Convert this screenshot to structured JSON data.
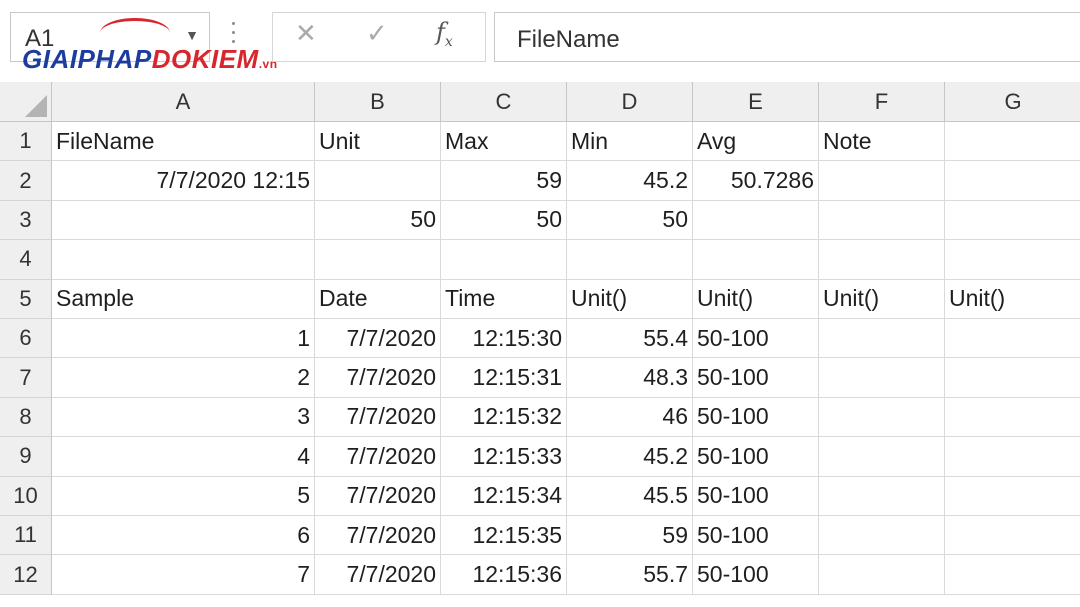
{
  "formula_bar": {
    "name_box": "A1",
    "name_box_caret": "▼",
    "cancel_glyph": "✕",
    "enter_glyph": "✓",
    "fx_glyph": "f",
    "fx_sub": "x",
    "content": "FileName"
  },
  "watermark": {
    "part1": "GIAIPHAP",
    "part2": "DOKIEM",
    "part3": ".vn"
  },
  "icons": {
    "cancel": "close-icon",
    "enter": "check-icon",
    "fx": "function-icon",
    "dropdown": "chevron-down-icon",
    "select_all": "select-all-triangle-icon"
  },
  "colors": {
    "watermark_blue": "#1d3d9e",
    "watermark_red": "#d8262d",
    "header_bg": "#efefef",
    "selection": "#217346"
  },
  "columns": [
    "A",
    "B",
    "C",
    "D",
    "E",
    "F",
    "G"
  ],
  "rows": [
    {
      "num": "1",
      "cells": [
        {
          "v": "FileName",
          "a": "left"
        },
        {
          "v": "Unit",
          "a": "left"
        },
        {
          "v": "Max",
          "a": "left"
        },
        {
          "v": "Min",
          "a": "left"
        },
        {
          "v": "Avg",
          "a": "left"
        },
        {
          "v": "Note",
          "a": "left"
        },
        {
          "v": "",
          "a": "left"
        }
      ]
    },
    {
      "num": "2",
      "cells": [
        {
          "v": "7/7/2020 12:15",
          "a": "right"
        },
        {
          "v": "",
          "a": "left"
        },
        {
          "v": "59",
          "a": "right"
        },
        {
          "v": "45.2",
          "a": "right"
        },
        {
          "v": "50.7286",
          "a": "right"
        },
        {
          "v": "",
          "a": "left"
        },
        {
          "v": "",
          "a": "left"
        }
      ]
    },
    {
      "num": "3",
      "cells": [
        {
          "v": "",
          "a": "left"
        },
        {
          "v": "50",
          "a": "right"
        },
        {
          "v": "50",
          "a": "right"
        },
        {
          "v": "50",
          "a": "right"
        },
        {
          "v": "",
          "a": "left"
        },
        {
          "v": "",
          "a": "left"
        },
        {
          "v": "",
          "a": "left"
        }
      ]
    },
    {
      "num": "4",
      "cells": [
        {
          "v": "",
          "a": "left"
        },
        {
          "v": "",
          "a": "left"
        },
        {
          "v": "",
          "a": "left"
        },
        {
          "v": "",
          "a": "left"
        },
        {
          "v": "",
          "a": "left"
        },
        {
          "v": "",
          "a": "left"
        },
        {
          "v": "",
          "a": "left"
        }
      ]
    },
    {
      "num": "5",
      "cells": [
        {
          "v": "Sample",
          "a": "left"
        },
        {
          "v": "Date",
          "a": "left"
        },
        {
          "v": "Time",
          "a": "left"
        },
        {
          "v": "Unit()",
          "a": "left"
        },
        {
          "v": "Unit()",
          "a": "left"
        },
        {
          "v": "Unit()",
          "a": "left"
        },
        {
          "v": "Unit()",
          "a": "left"
        }
      ]
    },
    {
      "num": "6",
      "cells": [
        {
          "v": "1",
          "a": "right"
        },
        {
          "v": "7/7/2020",
          "a": "right"
        },
        {
          "v": "12:15:30",
          "a": "right"
        },
        {
          "v": "55.4",
          "a": "right"
        },
        {
          "v": "50-100",
          "a": "left"
        },
        {
          "v": "",
          "a": "left"
        },
        {
          "v": "",
          "a": "left"
        }
      ]
    },
    {
      "num": "7",
      "cells": [
        {
          "v": "2",
          "a": "right"
        },
        {
          "v": "7/7/2020",
          "a": "right"
        },
        {
          "v": "12:15:31",
          "a": "right"
        },
        {
          "v": "48.3",
          "a": "right"
        },
        {
          "v": "50-100",
          "a": "left"
        },
        {
          "v": "",
          "a": "left"
        },
        {
          "v": "",
          "a": "left"
        }
      ]
    },
    {
      "num": "8",
      "cells": [
        {
          "v": "3",
          "a": "right"
        },
        {
          "v": "7/7/2020",
          "a": "right"
        },
        {
          "v": "12:15:32",
          "a": "right"
        },
        {
          "v": "46",
          "a": "right"
        },
        {
          "v": "50-100",
          "a": "left"
        },
        {
          "v": "",
          "a": "left"
        },
        {
          "v": "",
          "a": "left"
        }
      ]
    },
    {
      "num": "9",
      "cells": [
        {
          "v": "4",
          "a": "right"
        },
        {
          "v": "7/7/2020",
          "a": "right"
        },
        {
          "v": "12:15:33",
          "a": "right"
        },
        {
          "v": "45.2",
          "a": "right"
        },
        {
          "v": "50-100",
          "a": "left"
        },
        {
          "v": "",
          "a": "left"
        },
        {
          "v": "",
          "a": "left"
        }
      ]
    },
    {
      "num": "10",
      "cells": [
        {
          "v": "5",
          "a": "right"
        },
        {
          "v": "7/7/2020",
          "a": "right"
        },
        {
          "v": "12:15:34",
          "a": "right"
        },
        {
          "v": "45.5",
          "a": "right"
        },
        {
          "v": "50-100",
          "a": "left"
        },
        {
          "v": "",
          "a": "left"
        },
        {
          "v": "",
          "a": "left"
        }
      ]
    },
    {
      "num": "11",
      "cells": [
        {
          "v": "6",
          "a": "right"
        },
        {
          "v": "7/7/2020",
          "a": "right"
        },
        {
          "v": "12:15:35",
          "a": "right"
        },
        {
          "v": "59",
          "a": "right"
        },
        {
          "v": "50-100",
          "a": "left"
        },
        {
          "v": "",
          "a": "left"
        },
        {
          "v": "",
          "a": "left"
        }
      ]
    },
    {
      "num": "12",
      "cells": [
        {
          "v": "7",
          "a": "right"
        },
        {
          "v": "7/7/2020",
          "a": "right"
        },
        {
          "v": "12:15:36",
          "a": "right"
        },
        {
          "v": "55.7",
          "a": "right"
        },
        {
          "v": "50-100",
          "a": "left"
        },
        {
          "v": "",
          "a": "left"
        },
        {
          "v": "",
          "a": "left"
        }
      ]
    }
  ]
}
